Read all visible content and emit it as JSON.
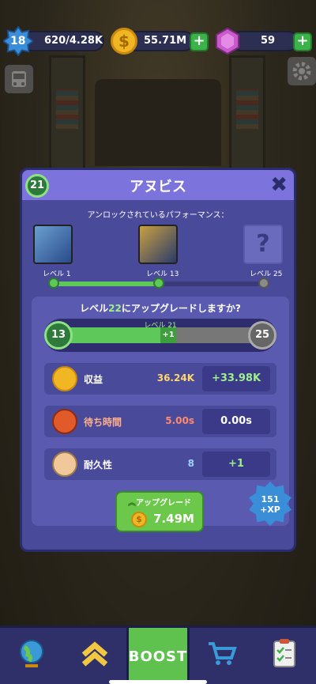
{
  "topbar": {
    "player_level": "18",
    "xp": "620/4.28K",
    "coins": "55.71M",
    "gems": "59",
    "coin_symbol": "$",
    "plus": "+"
  },
  "modal": {
    "level": "21",
    "title": "アヌビス",
    "close": "✖",
    "unlock_title": "アンロックされているパフォーマンス：",
    "performances": [
      {
        "label": "レベル 1"
      },
      {
        "label": "レベル 13"
      },
      {
        "label": "レベル 25",
        "locked_symbol": "?"
      }
    ],
    "unlock_progress": 0.5,
    "question_prefix": "レベル",
    "question_level": "22",
    "question_suffix": "にアップグレードしますか?",
    "bar": {
      "label": "レベル 21",
      "start": "13",
      "end": "25",
      "add": "+1",
      "progress": 0.58
    },
    "stats": [
      {
        "name": "収益",
        "value": "36.24K",
        "increase": "+33.98K",
        "icon": "money-hand-icon"
      },
      {
        "name": "待ち時間",
        "value": "5.00s",
        "increase": "0.00s",
        "icon": "stopwatch-icon"
      },
      {
        "name": "耐久性",
        "value": "8",
        "increase": "+1",
        "icon": "crowd-icon"
      }
    ],
    "upgrade": {
      "label": "アップグレード",
      "price": "7.49M"
    },
    "xp_badge": {
      "amount": "151",
      "unit": "+XP"
    }
  },
  "nav": {
    "items": [
      "globe-icon",
      "upgrade-chevrons-icon",
      "boost-button",
      "cart-icon",
      "checklist-icon"
    ],
    "boost_label": "BOOST"
  },
  "colors": {
    "accent_green": "#5ec95a",
    "modal_bg": "#4a4a9a",
    "header": "#7d73dc"
  }
}
